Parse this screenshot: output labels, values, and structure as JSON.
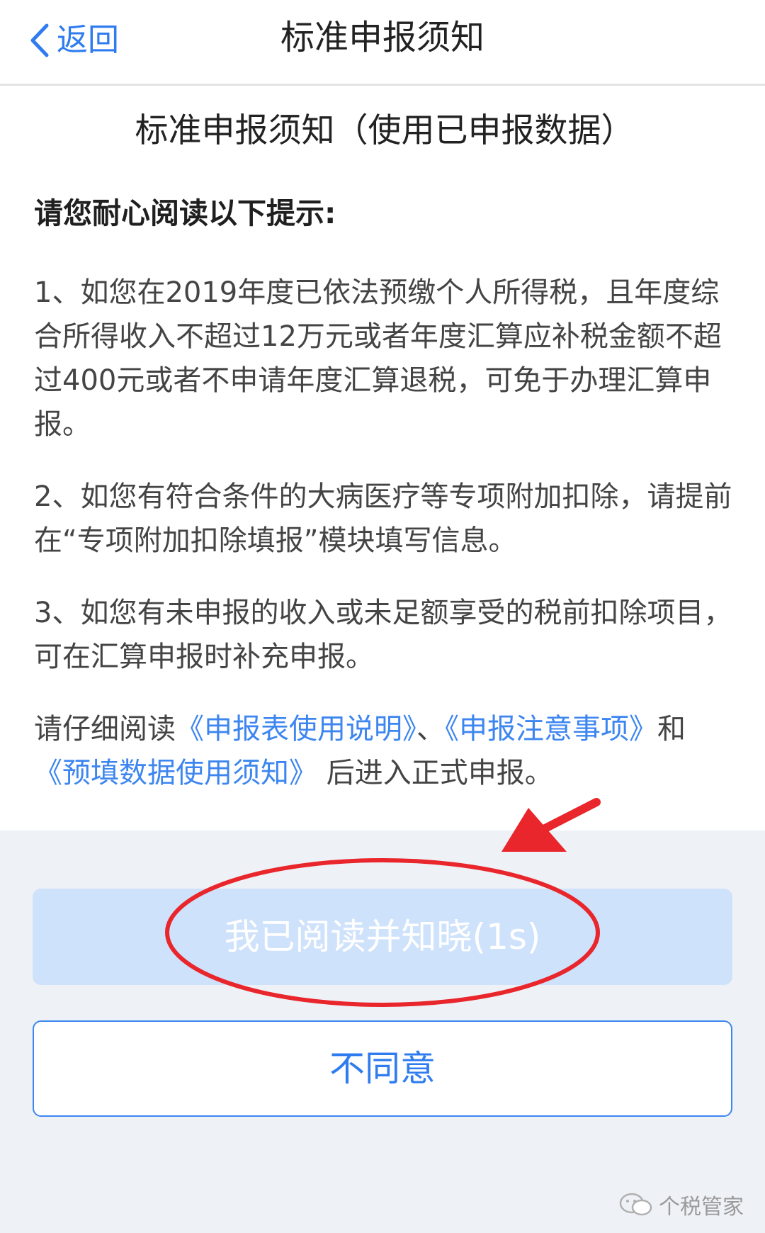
{
  "nav": {
    "back_label": "返回",
    "title": "标准申报须知"
  },
  "content": {
    "doc_title": "标准申报须知（使用已申报数据）",
    "intro": "请您耐心阅读以下提示:",
    "items": [
      "1、如您在2019年度已依法预缴个人所得税，且年度综合所得收入不超过12万元或者年度汇算应补税金额不超过400元或者不申请年度汇算退税，可免于办理汇算申报。",
      "2、如您有符合条件的大病医疗等专项附加扣除，请提前在“专项附加扣除填报”模块填写信息。",
      "3、如您有未申报的收入或未足额享受的税前扣除项目，可在汇算申报时补充申报。"
    ],
    "notice_prefix": "请仔细阅读",
    "link_1": "《申报表使用说明》",
    "sep_1": "、",
    "link_2": "《申报注意事项》",
    "sep_2": "和",
    "link_3": "《预填数据使用须知》",
    "notice_suffix": "后进入正式申报。"
  },
  "buttons": {
    "agree_label": "我已阅读并知晓(1s)",
    "disagree_label": "不同意"
  },
  "watermark": {
    "text": "个税管家"
  },
  "colors": {
    "accent": "#2f7cf0",
    "link": "#3d86f0",
    "agree_disabled_bg": "#cfe2fb",
    "annotation_red": "#e8262b"
  }
}
